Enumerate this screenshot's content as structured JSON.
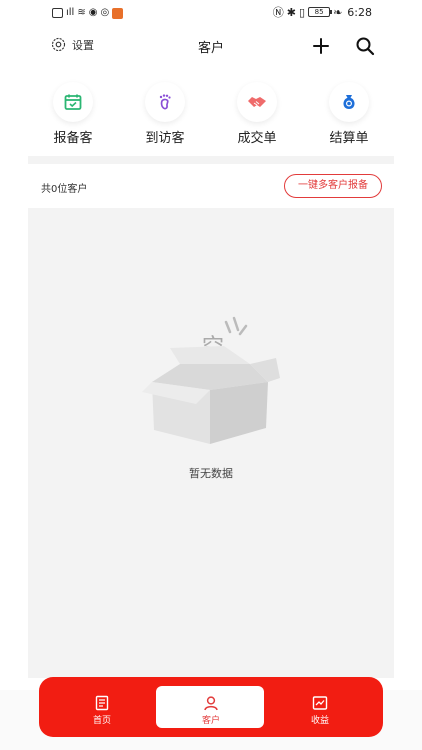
{
  "status_bar": {
    "time": "6:28",
    "battery": "85"
  },
  "header": {
    "settings_label": "设置",
    "title": "客户"
  },
  "quick_actions": [
    {
      "label": "报备客",
      "icon": "calendar-check-icon",
      "color": "#2bb673"
    },
    {
      "label": "到访客",
      "icon": "footprint-icon",
      "color": "#8a4fd6"
    },
    {
      "label": "成交单",
      "icon": "handshake-icon",
      "color": "#ef6b6b"
    },
    {
      "label": "结算单",
      "icon": "money-bag-icon",
      "color": "#1e6fd9"
    }
  ],
  "customers": {
    "count_text": "共0位客户",
    "batch_report_label": "一键多客户报备"
  },
  "empty_state": {
    "illustration_text": "空",
    "message": "暂无数据"
  },
  "bottom_nav": [
    {
      "label": "首页",
      "icon": "home-doc-icon",
      "active": false
    },
    {
      "label": "客户",
      "icon": "person-icon",
      "active": true
    },
    {
      "label": "收益",
      "icon": "chart-icon",
      "active": false
    }
  ],
  "colors": {
    "accent": "#f21d12",
    "accent_text": "#e23b3b",
    "background": "#f3f3f3"
  }
}
